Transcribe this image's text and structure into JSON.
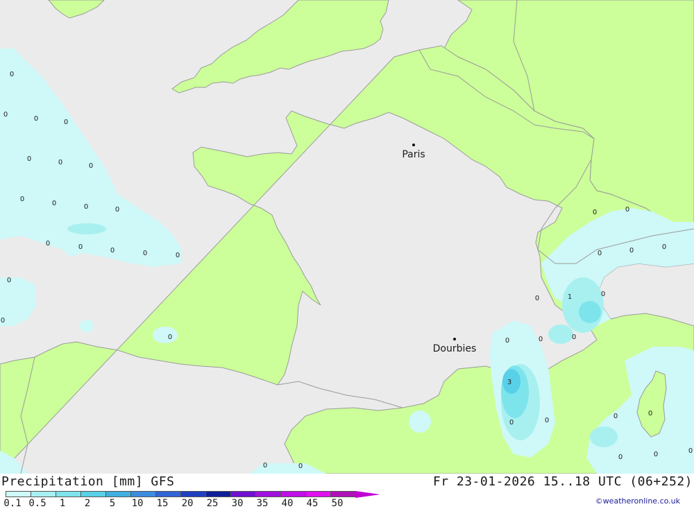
{
  "map": {
    "colors": {
      "sea": "#ebebeb",
      "land": "#ccff99",
      "border": "#9a9a9a",
      "precip_0_1": "#cff8f8",
      "precip_1": "#a8f0f0",
      "precip_2": "#7ee4ec",
      "precip_3": "#58d0e8"
    },
    "cities": [
      {
        "name": "Paris"
      },
      {
        "name": "Dourbies"
      }
    ],
    "value_labels": [
      "0",
      "0",
      "0",
      "0",
      "0",
      "0",
      "0",
      "0",
      "0",
      "0",
      "0",
      "0",
      "0",
      "0",
      "0",
      "0",
      "0",
      "0",
      "0",
      "0",
      "0",
      "0",
      "0",
      "0",
      "0",
      "0",
      "0",
      "0",
      "0",
      "1",
      "0",
      "0",
      "0",
      "0",
      "3",
      "0",
      "0",
      "0",
      "0",
      "0",
      "0",
      "0",
      "0",
      "0"
    ]
  },
  "footer": {
    "title": "Precipitation [mm] GFS",
    "datetime": "Fr 23-01-2026 15..18 UTC (06+252)",
    "credit": "©weatheronline.co.uk",
    "legend": {
      "ticks": [
        "0.1",
        "0.5",
        "1",
        "2",
        "5",
        "10",
        "15",
        "20",
        "25",
        "30",
        "35",
        "40",
        "45",
        "50"
      ],
      "colors": [
        "#cff8f8",
        "#a8f0f0",
        "#7ee4ec",
        "#58d0e8",
        "#40b0e0",
        "#3c8ce0",
        "#3264d8",
        "#2040c0",
        "#10209a",
        "#7010d0",
        "#a010e0",
        "#c010e8",
        "#e010f0",
        "#b010b8"
      ],
      "arrow_color": "#c000d0"
    }
  }
}
